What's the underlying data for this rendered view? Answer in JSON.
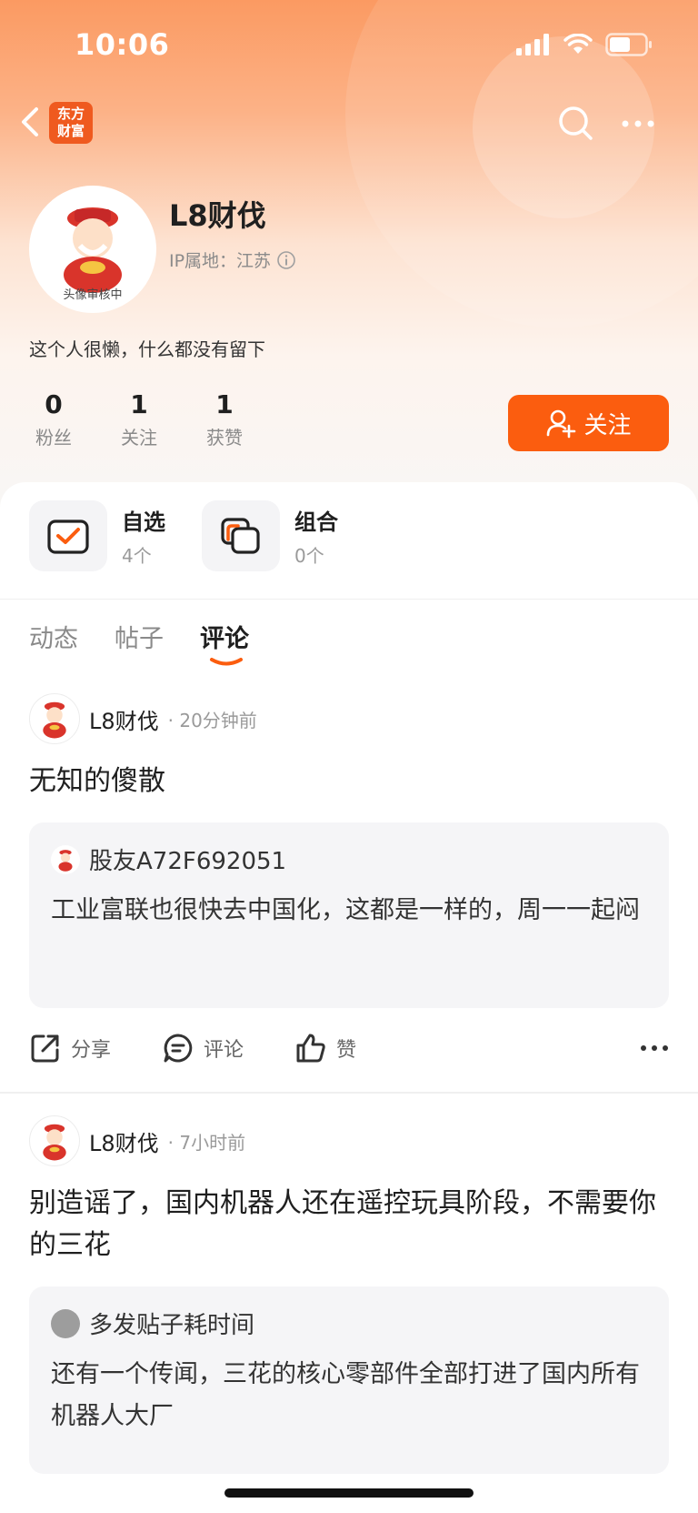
{
  "status_bar": {
    "time": "10:06"
  },
  "nav": {
    "logo_line1": "东方",
    "logo_line2": "财富"
  },
  "profile": {
    "name": "L8财伐",
    "avatar_caption": "头像审核中",
    "ip_label": "IP属地：江苏",
    "bio": "这个人很懒，什么都没有留下",
    "stats": [
      {
        "value": "0",
        "label": "粉丝"
      },
      {
        "value": "1",
        "label": "关注"
      },
      {
        "value": "1",
        "label": "获赞"
      }
    ],
    "follow_label": "关注"
  },
  "assets": [
    {
      "title": "自选",
      "count": "4个"
    },
    {
      "title": "组合",
      "count": "0个"
    }
  ],
  "tabs": [
    {
      "label": "动态",
      "active": false
    },
    {
      "label": "帖子",
      "active": false
    },
    {
      "label": "评论",
      "active": true
    }
  ],
  "posts": [
    {
      "author": "L8财伐",
      "time": "· 20分钟前",
      "text": "无知的傻散",
      "quote_author": "股友A72F692051",
      "quote_text": "工业富联也很快去中国化，这都是一样的，周一一起闷"
    },
    {
      "author": "L8财伐",
      "time": "· 7小时前",
      "text": "别造谣了，国内机器人还在遥控玩具阶段，不需要你的三花",
      "quote_author": "多发贴子耗时间",
      "quote_text": "还有一个传闻，三花的核心零部件全部打进了国内所有机器人大厂"
    }
  ],
  "actions": {
    "share": "分享",
    "comment": "评论",
    "like": "赞"
  },
  "colors": {
    "accent": "#fb5d0f",
    "header_top": "#fb9a62"
  }
}
